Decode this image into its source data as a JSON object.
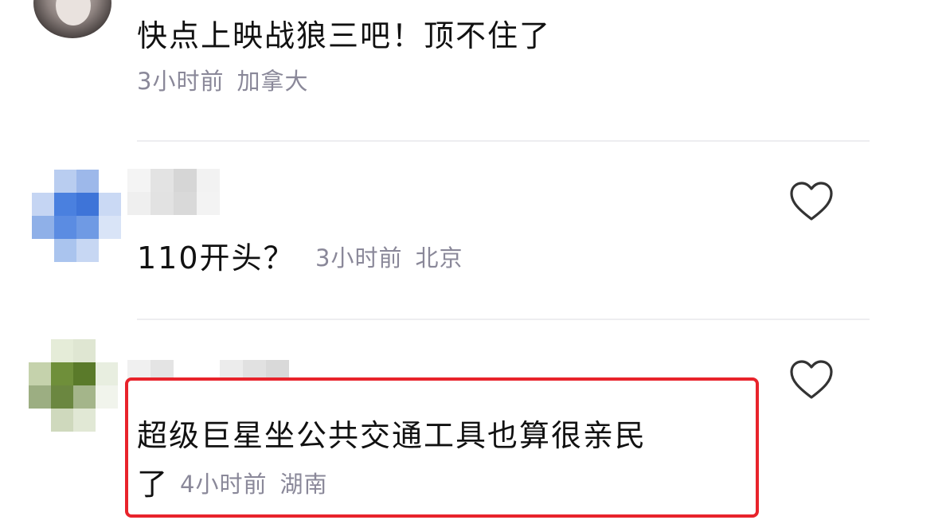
{
  "comments": [
    {
      "text": "快点上映战狼三吧！顶不住了",
      "time": "3小时前",
      "location": "加拿大"
    },
    {
      "text": "110开头？",
      "time": "3小时前",
      "location": "北京",
      "like_icon": "heart-outline-icon"
    },
    {
      "text_line1": "超级巨星坐公共交通工具也算很亲民",
      "text_line2": "了",
      "time": "4小时前",
      "location": "湖南",
      "like_icon": "heart-outline-icon",
      "highlight_color": "#e8232b"
    }
  ]
}
